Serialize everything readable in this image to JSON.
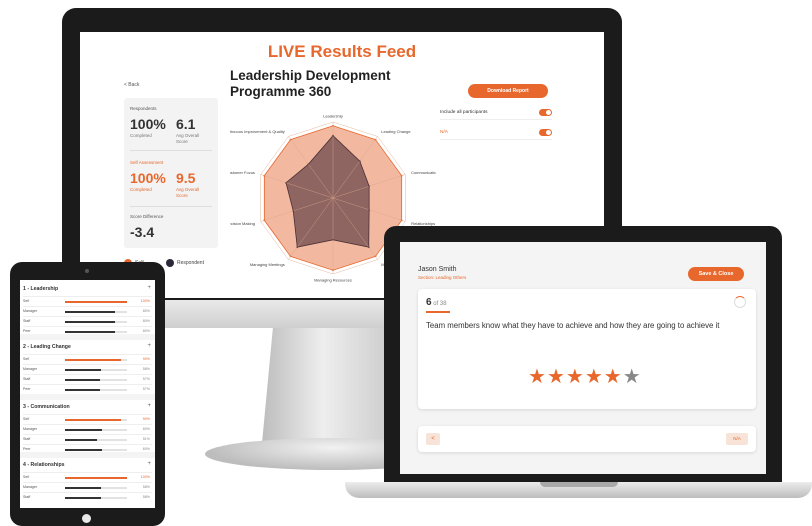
{
  "colors": {
    "accent": "#e8672c",
    "self_fill": "#f2b9a0",
    "respondent_fill": "#6e4a4e",
    "dark": "#1b1b1b"
  },
  "desktop": {
    "feed_title": "LIVE Results Feed",
    "back_label": "< Back",
    "report_title": "Leadership Development Programme 360",
    "download_label": "Download Report",
    "options": [
      {
        "label": "Include all participants",
        "on": true
      },
      {
        "label": "N/A",
        "on": true
      }
    ],
    "stats": {
      "respondents_label": "Respondents",
      "respondents_completed_pct": "100%",
      "completed_label": "Completed",
      "respondents_avg": "6.1",
      "avg_label": "Avg Overall Score",
      "self_label": "Self Assessment",
      "self_completed_pct": "100%",
      "self_completed_label": "Completed",
      "self_avg": "9.5",
      "self_avg_label": "Avg Overall Score",
      "difference_label": "Score Difference",
      "difference": "-3.4"
    },
    "legend": {
      "self": "Self",
      "respondent": "Respondent"
    },
    "chart_data": {
      "type": "radar",
      "title": "",
      "axes": [
        "Leadership",
        "Leading Change",
        "Communication",
        "Relationships",
        "Managing Performance",
        "Managing Resources",
        "Managing Meetings",
        "Decision Making",
        "Customer Focus",
        "Continuous Improvement & Quality"
      ],
      "range": [
        0,
        10
      ],
      "series": [
        {
          "name": "Self",
          "values": [
            9.5,
            9.5,
            9.5,
            9.5,
            9.5,
            9.5,
            9.5,
            9.5,
            9.5,
            9.5
          ]
        },
        {
          "name": "Respondent",
          "values": [
            8.2,
            6.0,
            5.0,
            5.0,
            8.0,
            5.5,
            8.0,
            5.5,
            6.5,
            5.5
          ]
        }
      ]
    }
  },
  "tablet": {
    "row_labels": [
      "Self",
      "Manager",
      "Staff",
      "Peer"
    ],
    "sections": [
      {
        "title": "1 - Leadership",
        "rows": [
          {
            "pct": 100,
            "text": "100%"
          },
          {
            "pct": 80,
            "text": "80%"
          },
          {
            "pct": 80,
            "text": "80%"
          },
          {
            "pct": 80,
            "text": "80%"
          }
        ]
      },
      {
        "title": "2 - Leading Change",
        "rows": [
          {
            "pct": 90,
            "text": "90%"
          },
          {
            "pct": 58,
            "text": "58%"
          },
          {
            "pct": 57,
            "text": "57%"
          },
          {
            "pct": 57,
            "text": "57%"
          }
        ]
      },
      {
        "title": "3 - Communication",
        "rows": [
          {
            "pct": 90,
            "text": "90%"
          },
          {
            "pct": 60,
            "text": "60%"
          },
          {
            "pct": 51,
            "text": "51%"
          },
          {
            "pct": 60,
            "text": "60%"
          }
        ]
      },
      {
        "title": "4 - Relationships",
        "rows": [
          {
            "pct": 100,
            "text": "100%"
          },
          {
            "pct": 58,
            "text": "58%"
          },
          {
            "pct": 58,
            "text": "58%"
          }
        ]
      }
    ]
  },
  "laptop": {
    "name": "Jason Smith",
    "section": "Section: Leading Others",
    "save_label": "Save & Close",
    "question_number": "6",
    "question_total": "of 38",
    "question": "Team members know what they have to achieve and how they are going to achieve it",
    "rating": 5,
    "rating_max": 6,
    "prev_label": "<",
    "na_label": "N/A"
  }
}
